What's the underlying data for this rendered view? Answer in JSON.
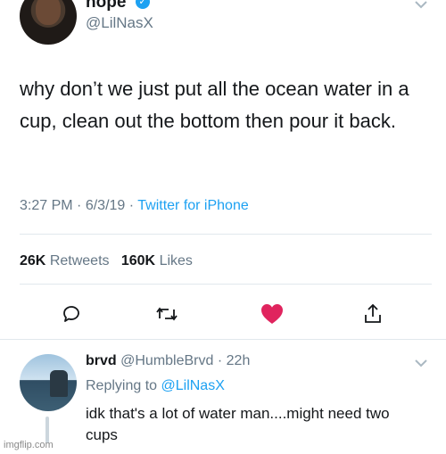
{
  "tweet": {
    "display_name": "nope",
    "handle": "@LilNasX",
    "text": "why don’t we just put all the ocean water in a cup, clean out the bottom then pour it back.",
    "time": "3:27 PM",
    "date": "6/3/19",
    "source": "Twitter for iPhone",
    "retweets_count": "26K",
    "retweets_label": "Retweets",
    "likes_count": "160K",
    "likes_label": "Likes"
  },
  "reply": {
    "display_name": "brvd",
    "handle": "@HumbleBrvd",
    "age": "22h",
    "replying_prefix": "Replying to",
    "replying_to": "@LilNasX",
    "text": "idk that's a lot of water man....might need two cups"
  },
  "icons": {
    "verified": "verified-badge-icon",
    "chevron": "chevron-down-icon",
    "reply": "reply-icon",
    "retweet": "retweet-icon",
    "like": "heart-icon",
    "share": "share-icon"
  },
  "colors": {
    "accent": "#1da1f2",
    "like": "#e0245e",
    "muted": "#657786",
    "divider": "#e1e8ed"
  },
  "watermark": "imgflip.com"
}
